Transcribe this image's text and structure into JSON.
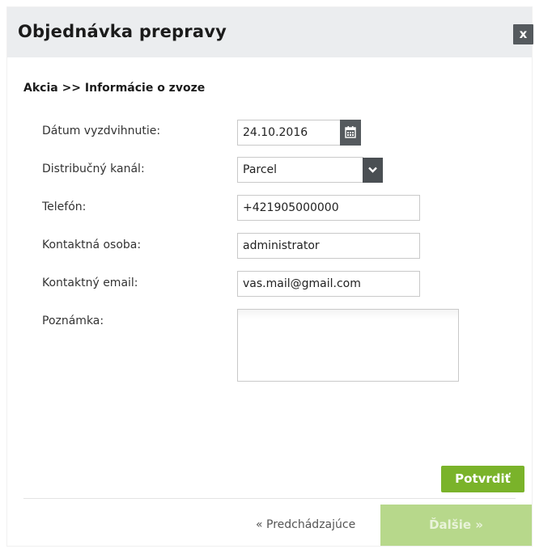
{
  "dialog": {
    "title": "Objednávka prepravy",
    "close_label": "x"
  },
  "breadcrumb": "Akcia >> Informácie o zvoze",
  "form": {
    "pickup_date": {
      "label": "Dátum vyzdvihnutie:",
      "value": "24.10.2016"
    },
    "channel": {
      "label": "Distribučný kanál:",
      "value": "Parcel"
    },
    "phone": {
      "label": "Telefón:",
      "value": "+421905000000"
    },
    "contact_person": {
      "label": "Kontaktná osoba:",
      "value": "administrator"
    },
    "contact_email": {
      "label": "Kontaktný email:",
      "value": "vas.mail@gmail.com"
    },
    "note": {
      "label": "Poznámka:",
      "value": ""
    }
  },
  "actions": {
    "confirm_label": "Potvrdiť",
    "prev_label": "« Predchádzajúce",
    "next_label": "Ďalšie »"
  },
  "colors": {
    "accent": "#7ab32a",
    "accent_disabled": "#b7d88b",
    "header_bg": "#ebedef",
    "icon_dark": "#555a5e"
  }
}
